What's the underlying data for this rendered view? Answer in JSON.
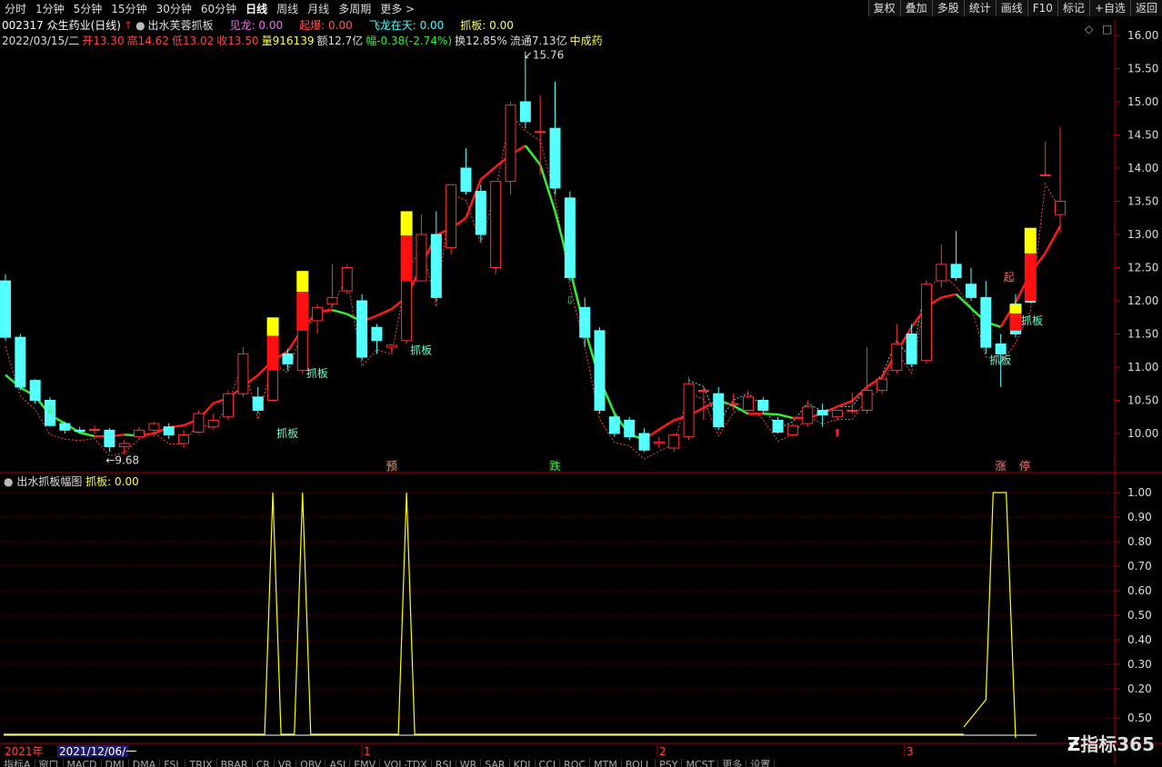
{
  "periods": [
    "分时",
    "1分钟",
    "5分钟",
    "15分钟",
    "30分钟",
    "60分钟",
    "日线",
    "周线",
    "月线",
    "多周期",
    "更多 >"
  ],
  "active_period": "日线",
  "right_buttons": [
    "复权",
    "叠加",
    "多股",
    "统计",
    "画线",
    "F10",
    "标记",
    "+自选",
    "返回"
  ],
  "stock": {
    "code_name": "002317 众生药业(日线)",
    "indicator": "出水芙蓉抓板"
  },
  "indicator_values": [
    {
      "label": "见龙: 0.00",
      "color": "#ff66ff"
    },
    {
      "label": "起爆: 0.00",
      "color": "#ff5555"
    },
    {
      "label": "飞龙在天: 0.00",
      "color": "#44ffff"
    },
    {
      "label": "抓板: 0.00",
      "color": "#ffff55"
    }
  ],
  "quote": {
    "date": "2022/03/15/二",
    "open": "开13.30",
    "high": "高14.62",
    "low": "低13.02",
    "close": "收13.50",
    "volume": "量916139",
    "amount": "额12.7亿",
    "change": "幅-0.38(-2.74%)",
    "turnover": "换12.85%",
    "float": "流通7.13亿",
    "concept": "中成药"
  },
  "price_axis": [
    "16.00",
    "15.50",
    "15.00",
    "14.50",
    "14.00",
    "13.50",
    "13.00",
    "12.50",
    "12.00",
    "11.50",
    "11.00",
    "10.50",
    "10.00"
  ],
  "price_range": [
    9.6,
    16.0
  ],
  "sub_axis": [
    "1.00",
    "0.90",
    "0.80",
    "0.70",
    "0.60",
    "0.50",
    "0.40",
    "0.30",
    "0.20",
    "0.50"
  ],
  "annotations": {
    "high_label": "15.76",
    "low_label": "9.68",
    "zhuaban": "抓板",
    "qi": "起",
    "yu": "预",
    "die": "跌",
    "zhang": "涨",
    "ting": "停"
  },
  "sub_panel": {
    "title": "出水抓板幅图",
    "value": "抓板: 0.00"
  },
  "time_axis": {
    "year": "2021年",
    "selected_date": "2021/12/06/一",
    "months": [
      "1",
      "2",
      "3"
    ]
  },
  "bottom_tabs": [
    "指标A",
    "窗口",
    "MACD",
    "DMI",
    "DMA",
    "FSL",
    "TRIX",
    "BRAR",
    "CR",
    "VR",
    "OBV",
    "ASI",
    "EMV",
    "VOL-TDX",
    "RSI",
    "WR",
    "SAR",
    "KDJ",
    "CCI",
    "ROC",
    "MTM",
    "BOLL",
    "PSY",
    "MCST",
    "更多",
    "设置"
  ],
  "brand": "指标365",
  "colors": {
    "up": "#ff3232",
    "down": "#54ffff",
    "ma_up": "#ff1a1a",
    "ma_down": "#33ee33",
    "yellow": "#ffff00",
    "grid": "#8b0000"
  },
  "candles": [
    {
      "o": 12.3,
      "h": 12.4,
      "l": 11.4,
      "c": 11.45
    },
    {
      "o": 11.45,
      "h": 11.5,
      "l": 10.65,
      "c": 10.7
    },
    {
      "o": 10.8,
      "h": 10.82,
      "l": 10.45,
      "c": 10.5
    },
    {
      "o": 10.5,
      "h": 10.55,
      "l": 10.1,
      "c": 10.12
    },
    {
      "o": 10.15,
      "h": 10.18,
      "l": 10.0,
      "c": 10.05
    },
    {
      "o": 10.05,
      "h": 10.1,
      "l": 10.0,
      "c": 10.03
    },
    {
      "o": 10.05,
      "h": 10.12,
      "l": 10.0,
      "c": 10.06
    },
    {
      "o": 10.05,
      "h": 10.08,
      "l": 9.72,
      "c": 9.8
    },
    {
      "o": 9.8,
      "h": 9.9,
      "l": 9.68,
      "c": 9.85
    },
    {
      "o": 9.95,
      "h": 10.1,
      "l": 9.9,
      "c": 10.05
    },
    {
      "o": 10.05,
      "h": 10.18,
      "l": 9.95,
      "c": 10.15
    },
    {
      "o": 10.1,
      "h": 10.15,
      "l": 9.92,
      "c": 9.98
    },
    {
      "o": 9.85,
      "h": 10.05,
      "l": 9.78,
      "c": 9.98
    },
    {
      "o": 10.02,
      "h": 10.35,
      "l": 10.0,
      "c": 10.3
    },
    {
      "o": 10.1,
      "h": 10.3,
      "l": 10.08,
      "c": 10.2
    },
    {
      "o": 10.25,
      "h": 10.65,
      "l": 10.2,
      "c": 10.6
    },
    {
      "o": 10.6,
      "h": 11.3,
      "l": 10.55,
      "c": 11.2
    },
    {
      "o": 10.55,
      "h": 10.7,
      "l": 10.3,
      "c": 10.35
    },
    {
      "o": 10.5,
      "h": 11.28,
      "l": 10.48,
      "c": 11.2
    },
    {
      "o": 11.2,
      "h": 11.28,
      "l": 10.95,
      "c": 11.05
    },
    {
      "o": 10.95,
      "h": 11.72,
      "l": 10.9,
      "c": 11.7
    },
    {
      "o": 11.7,
      "h": 11.95,
      "l": 11.5,
      "c": 11.9
    },
    {
      "o": 11.95,
      "h": 12.55,
      "l": 11.9,
      "c": 12.05
    },
    {
      "o": 12.15,
      "h": 12.55,
      "l": 12.1,
      "c": 12.5
    },
    {
      "o": 12.0,
      "h": 12.1,
      "l": 11.1,
      "c": 11.15
    },
    {
      "o": 11.6,
      "h": 11.65,
      "l": 11.2,
      "c": 11.4
    },
    {
      "o": 11.3,
      "h": 11.35,
      "l": 11.22,
      "c": 11.33
    },
    {
      "o": 11.4,
      "h": 12.5,
      "l": 11.35,
      "c": 12.5
    },
    {
      "o": 12.3,
      "h": 13.3,
      "l": 12.5,
      "c": 13.0
    },
    {
      "o": 13.0,
      "h": 13.35,
      "l": 12.0,
      "c": 12.05
    },
    {
      "o": 12.8,
      "h": 13.5,
      "l": 12.7,
      "c": 13.75
    },
    {
      "o": 14.0,
      "h": 14.3,
      "l": 13.6,
      "c": 13.65
    },
    {
      "o": 13.65,
      "h": 13.75,
      "l": 12.9,
      "c": 13.0
    },
    {
      "o": 12.5,
      "h": 13.8,
      "l": 12.4,
      "c": 13.8
    },
    {
      "o": 13.8,
      "h": 15.0,
      "l": 13.6,
      "c": 14.95
    },
    {
      "o": 15.0,
      "h": 15.76,
      "l": 14.6,
      "c": 14.7
    },
    {
      "o": 14.55,
      "h": 15.1,
      "l": 13.9,
      "c": 14.55
    },
    {
      "o": 14.6,
      "h": 15.3,
      "l": 13.6,
      "c": 13.7
    },
    {
      "o": 13.55,
      "h": 13.65,
      "l": 12.3,
      "c": 12.35
    },
    {
      "o": 11.9,
      "h": 12.05,
      "l": 11.3,
      "c": 11.45
    },
    {
      "o": 11.55,
      "h": 11.6,
      "l": 10.3,
      "c": 10.35
    },
    {
      "o": 10.25,
      "h": 10.3,
      "l": 9.95,
      "c": 10.0
    },
    {
      "o": 10.2,
      "h": 10.25,
      "l": 9.9,
      "c": 9.95
    },
    {
      "o": 10.0,
      "h": 10.08,
      "l": 9.72,
      "c": 9.75
    },
    {
      "o": 9.85,
      "h": 9.95,
      "l": 9.78,
      "c": 9.87
    },
    {
      "o": 9.78,
      "h": 10.0,
      "l": 9.72,
      "c": 9.98
    },
    {
      "o": 9.95,
      "h": 10.85,
      "l": 9.9,
      "c": 10.75
    },
    {
      "o": 10.65,
      "h": 10.72,
      "l": 10.2,
      "c": 10.65
    },
    {
      "o": 10.6,
      "h": 10.7,
      "l": 10.05,
      "c": 10.1
    },
    {
      "o": 10.45,
      "h": 10.6,
      "l": 10.35,
      "c": 10.45
    },
    {
      "o": 10.35,
      "h": 10.65,
      "l": 10.3,
      "c": 10.55
    },
    {
      "o": 10.5,
      "h": 10.55,
      "l": 10.3,
      "c": 10.35
    },
    {
      "o": 10.2,
      "h": 10.25,
      "l": 10.0,
      "c": 10.02
    },
    {
      "o": 9.98,
      "h": 10.15,
      "l": 9.95,
      "c": 10.12
    },
    {
      "o": 10.15,
      "h": 10.5,
      "l": 10.1,
      "c": 10.4
    },
    {
      "o": 10.35,
      "h": 10.45,
      "l": 10.1,
      "c": 10.28
    },
    {
      "o": 10.25,
      "h": 10.35,
      "l": 10.2,
      "c": 10.35
    },
    {
      "o": 10.35,
      "h": 10.62,
      "l": 10.3,
      "c": 10.35
    },
    {
      "o": 10.35,
      "h": 11.3,
      "l": 10.3,
      "c": 10.65
    },
    {
      "o": 10.65,
      "h": 10.85,
      "l": 10.6,
      "c": 10.82
    },
    {
      "o": 10.95,
      "h": 11.65,
      "l": 10.9,
      "c": 11.35
    },
    {
      "o": 11.5,
      "h": 11.65,
      "l": 11.0,
      "c": 11.05
    },
    {
      "o": 11.1,
      "h": 12.3,
      "l": 11.05,
      "c": 12.25
    },
    {
      "o": 12.3,
      "h": 12.85,
      "l": 12.2,
      "c": 12.55
    },
    {
      "o": 12.55,
      "h": 13.05,
      "l": 12.3,
      "c": 12.35
    },
    {
      "o": 12.25,
      "h": 12.5,
      "l": 12.0,
      "c": 12.05
    },
    {
      "o": 12.05,
      "h": 12.3,
      "l": 11.2,
      "c": 11.3
    },
    {
      "o": 11.35,
      "h": 11.5,
      "l": 10.7,
      "c": 11.2
    },
    {
      "o": 11.95,
      "h": 12.1,
      "l": 11.45,
      "c": 11.5
    },
    {
      "o": 13.05,
      "h": 13.08,
      "l": 11.98,
      "c": 11.98
    },
    {
      "o": 13.9,
      "h": 14.4,
      "l": 13.9,
      "c": 13.9
    },
    {
      "o": 13.3,
      "h": 14.62,
      "l": 13.02,
      "c": 13.5
    }
  ]
}
